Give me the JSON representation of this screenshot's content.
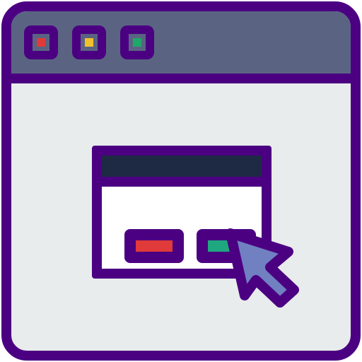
{
  "window": {
    "controls": [
      {
        "name": "close",
        "color": "#e03a3a"
      },
      {
        "name": "minimize",
        "color": "#f2c12e"
      },
      {
        "name": "maximize",
        "color": "#1fa86a"
      }
    ],
    "frame_color": "#4b0082",
    "titlebar_color": "#5a6482",
    "body_color": "#e8ecec"
  },
  "dialog": {
    "header_color": "#1e2a44",
    "body_color": "#ffffff",
    "buttons": [
      {
        "name": "cancel",
        "color": "#e03a3a"
      },
      {
        "name": "confirm",
        "color": "#1fa880"
      }
    ]
  },
  "cursor": {
    "icon": "pointer-arrow-icon",
    "color": "#7080c0"
  }
}
